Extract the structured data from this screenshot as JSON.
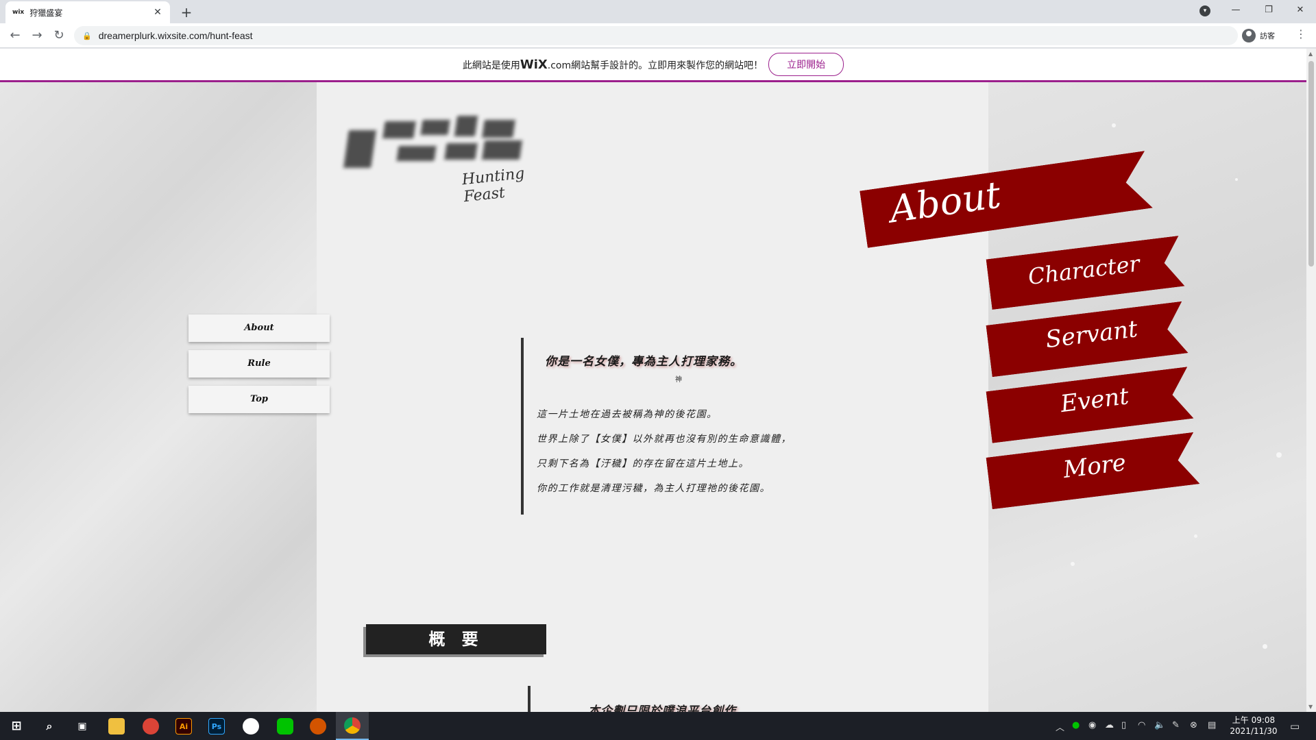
{
  "browser": {
    "tab_title": "狩獵盛宴",
    "tab_favicon": "wix",
    "url": "dreamerplurk.wixsite.com/hunt-feast",
    "profile_label": "訪客"
  },
  "wix_banner": {
    "text_before": "此網站是使用",
    "brand": "WiX",
    "text_after": ".com網站幫手設計的。立即用來製作您的網站吧！",
    "button": "立即開始",
    "accent_color": "#9b1f8c"
  },
  "site": {
    "logo_subtitle": "Hunting Feast",
    "side_menu": [
      "About",
      "Rule",
      "Top"
    ],
    "ribbons": [
      "About",
      "Character",
      "Servant",
      "Event",
      "More"
    ],
    "ribbon_color": "#8b0000",
    "intro_heading": "你是一名女僕，專為主人打理家務。",
    "intro_small": "神",
    "intro_lines": [
      "這一片土地在過去被稱為神的後花園。",
      "世界上除了【女僕】以外就再也沒有別的生命意識體，",
      "只剩下名為【汙穢】的存在留在這片土地上。",
      "你的工作就是清理污穢，為主人打理祂的後花園。"
    ],
    "section_title": "概 要",
    "section_first_line": "本企劃只限於噗浪平台創作"
  },
  "taskbar": {
    "clock_time": "上午 09:08",
    "clock_date": "2021/11/30"
  }
}
